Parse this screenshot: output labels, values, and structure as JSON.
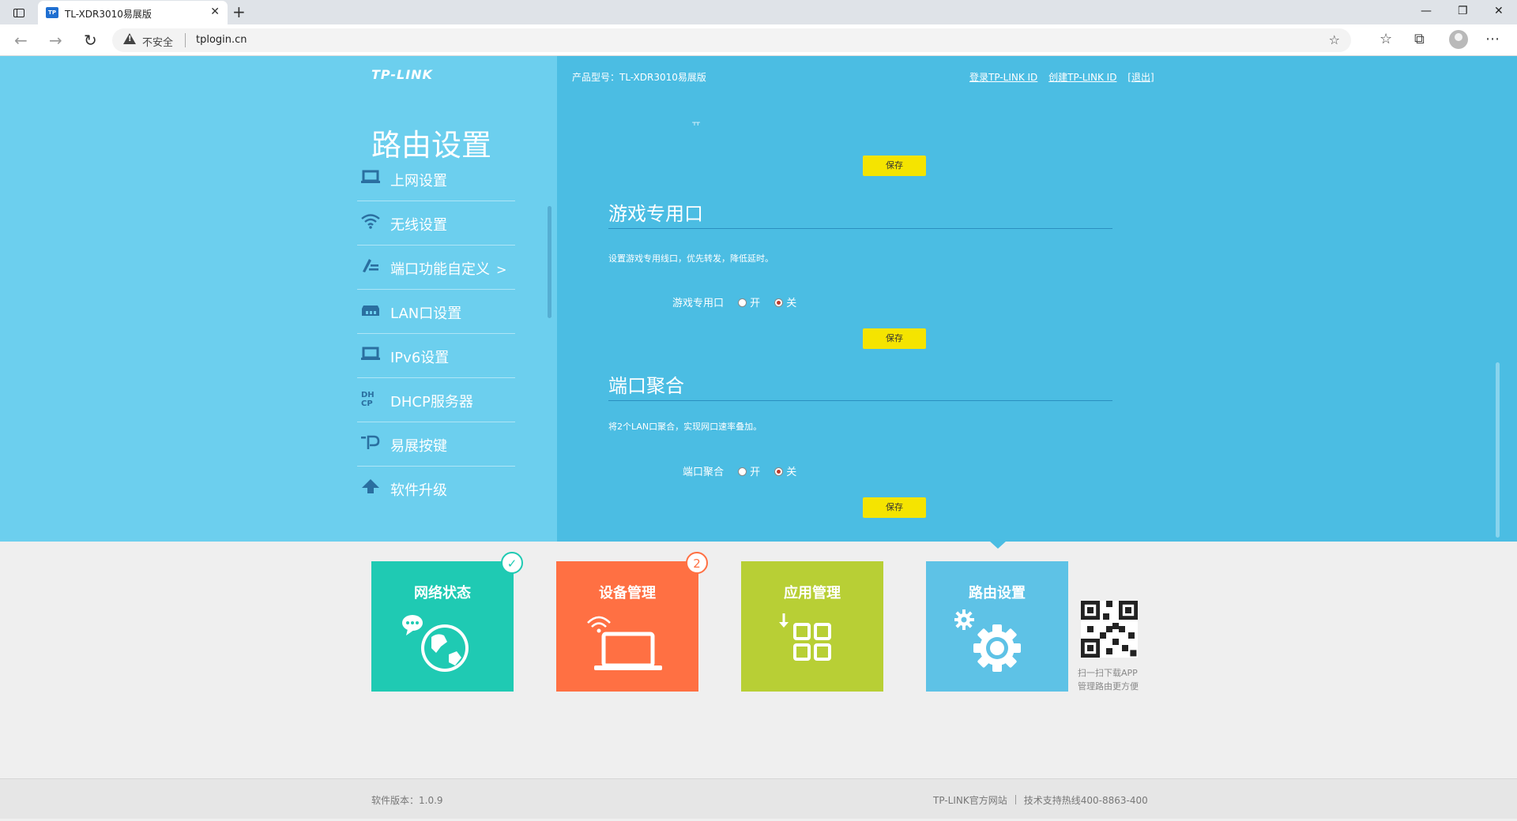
{
  "browser": {
    "tab_title": "TL-XDR3010易展版",
    "tab_favicon": "TP",
    "security_label": "不安全",
    "url": "tplogin.cn"
  },
  "header": {
    "logo": "TP-LINK",
    "model": "产品型号：TL-XDR3010易展版",
    "login_link": "登录TP-LINK ID",
    "create_link": "创建TP-LINK ID",
    "exit_link": "[退出]"
  },
  "sidebar": {
    "title": "路由设置",
    "items": [
      {
        "label": "上网设置",
        "icon": "laptop-icon"
      },
      {
        "label": "无线设置",
        "icon": "wifi-icon"
      },
      {
        "label": "端口功能自定义",
        "icon": "port-custom-icon",
        "active": true,
        "arrow": ">"
      },
      {
        "label": "LAN口设置",
        "icon": "lan-icon"
      },
      {
        "label": "IPv6设置",
        "icon": "laptop-icon"
      },
      {
        "label": "DHCP服务器",
        "icon": "dhcp-icon"
      },
      {
        "label": "易展按键",
        "icon": "easymesh-icon"
      },
      {
        "label": "软件升级",
        "icon": "upload-arrow-icon"
      }
    ]
  },
  "content": {
    "save_label": "保存",
    "game_port": {
      "title": "游戏专用口",
      "description": "设置游戏专用线口，优先转发，降低延时。",
      "field_label": "游戏专用口",
      "option_on": "开",
      "option_off": "关",
      "selected": "关"
    },
    "link_aggregation": {
      "title": "端口聚合",
      "description": "将2个LAN口聚合，实现网口速率叠加。",
      "field_label": "端口聚合",
      "option_on": "开",
      "option_off": "关",
      "selected": "关"
    }
  },
  "tiles": [
    {
      "label": "网络状态",
      "color": "#1fcab3",
      "badge": "✓"
    },
    {
      "label": "设备管理",
      "color": "#ff7043",
      "badge": "2"
    },
    {
      "label": "应用管理",
      "color": "#b8cf35"
    },
    {
      "label": "路由设置",
      "color": "#5ec2e6"
    }
  ],
  "qr": {
    "caption_line1": "扫一扫下载APP",
    "caption_line2": "管理路由更方便"
  },
  "footer": {
    "version": "软件版本：1.0.9",
    "official_site": "TP-LINK官方网站",
    "hotline": "技术支持热线400-8863-400"
  }
}
